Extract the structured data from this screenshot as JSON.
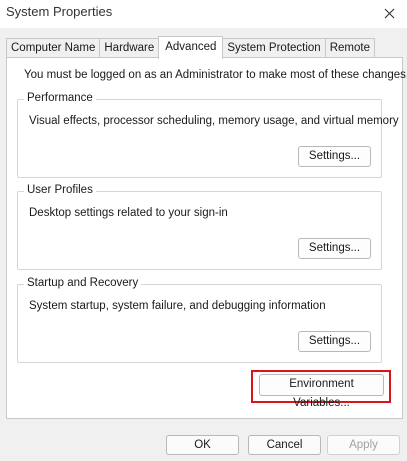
{
  "window": {
    "title": "System Properties"
  },
  "tabs": [
    {
      "label": "Computer Name"
    },
    {
      "label": "Hardware"
    },
    {
      "label": "Advanced",
      "active": true
    },
    {
      "label": "System Protection"
    },
    {
      "label": "Remote"
    }
  ],
  "advanced": {
    "notice": "You must be logged on as an Administrator to make most of these changes.",
    "performance": {
      "title": "Performance",
      "description": "Visual effects, processor scheduling, memory usage, and virtual memory",
      "button": "Settings..."
    },
    "user_profiles": {
      "title": "User Profiles",
      "description": "Desktop settings related to your sign-in",
      "button": "Settings..."
    },
    "startup_recovery": {
      "title": "Startup and Recovery",
      "description": "System startup, system failure, and debugging information",
      "button": "Settings..."
    },
    "env_button": "Environment Variables..."
  },
  "footer": {
    "ok": "OK",
    "cancel": "Cancel",
    "apply": "Apply"
  },
  "colors": {
    "highlight": "#d9141a",
    "window_bg": "#f0f0f0",
    "panel_bg": "#ffffff"
  },
  "icons": {
    "close": "close-icon"
  }
}
